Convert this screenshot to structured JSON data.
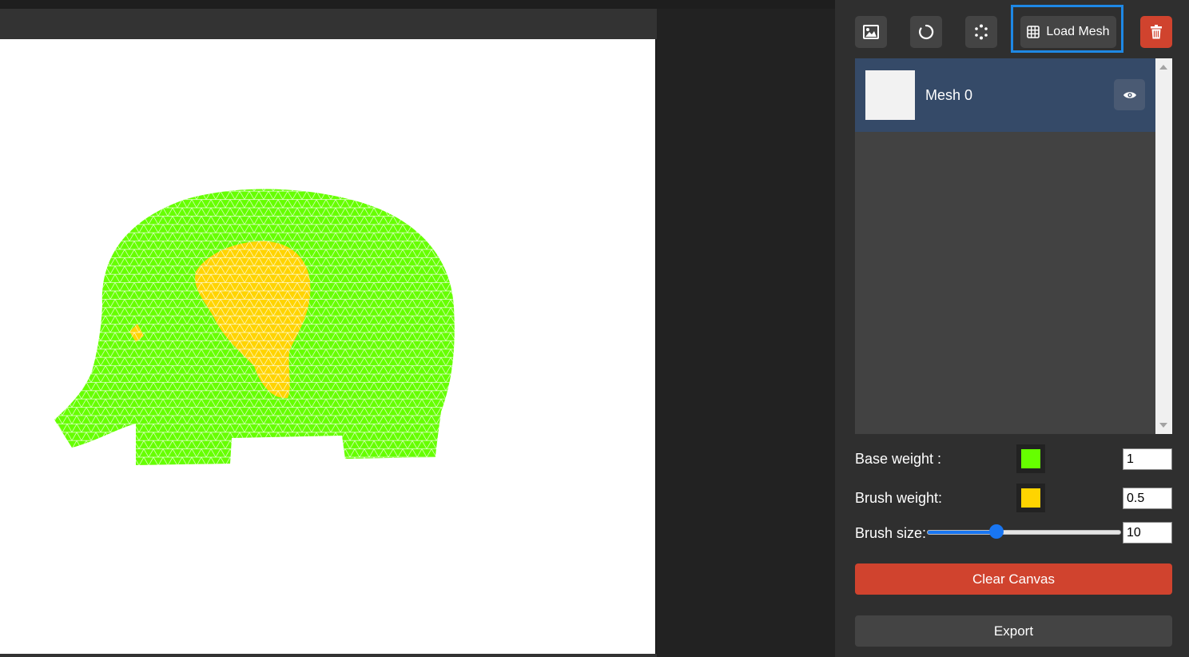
{
  "toolbar": {
    "load_mesh_label": "Load Mesh"
  },
  "mesh_list": {
    "items": [
      {
        "name": "Mesh 0"
      }
    ]
  },
  "weights": {
    "base_label": "Base weight :",
    "base_value": "1",
    "base_color": "#66ff00",
    "brush_label": "Brush weight:",
    "brush_value": "0.5",
    "brush_color": "#ffd400"
  },
  "brush": {
    "size_label": "Brush size:",
    "size_value": "10",
    "slider_min": 1,
    "slider_max": 26,
    "slider_fraction": 0.36
  },
  "actions": {
    "clear_label": "Clear Canvas",
    "export_label": "Export"
  },
  "colors": {
    "accent": "#1976f2",
    "danger": "#d0432e",
    "selected_item": "#354a68"
  },
  "icons": {
    "load_image": "image-icon",
    "reset": "circle-arrow-icon",
    "points": "dotted-circle-icon",
    "mesh": "grid-icon",
    "delete": "trash-icon",
    "visibility": "eye-icon"
  }
}
